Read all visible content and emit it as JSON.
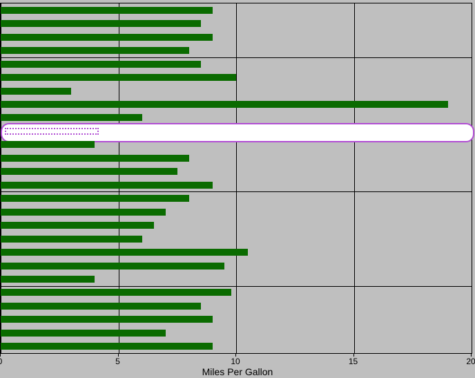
{
  "chart_data": {
    "type": "bar",
    "orientation": "horizontal",
    "xlabel": "Miles Per Gallon",
    "x_ticks": [
      0,
      5,
      10,
      15,
      20
    ],
    "xlim": [
      0,
      20
    ],
    "y_major_rows": [
      4,
      14,
      21
    ],
    "values": [
      9.0,
      8.5,
      9.0,
      8.0,
      8.5,
      10.0,
      3.0,
      19.0,
      6.0,
      20.0,
      4.0,
      8.0,
      7.5,
      9.0,
      8.0,
      7.0,
      6.5,
      6.0,
      10.5,
      9.5,
      4.0,
      9.8,
      8.5,
      9.0,
      7.0,
      9.0
    ],
    "highlight_index": 9,
    "highlight_dotted_value": 4.0
  },
  "style": {
    "bar_color": "#0a6b00",
    "plot_bg": "#bfbfbf",
    "grid_color": "#000000",
    "highlight_color": "#b14ed3"
  }
}
